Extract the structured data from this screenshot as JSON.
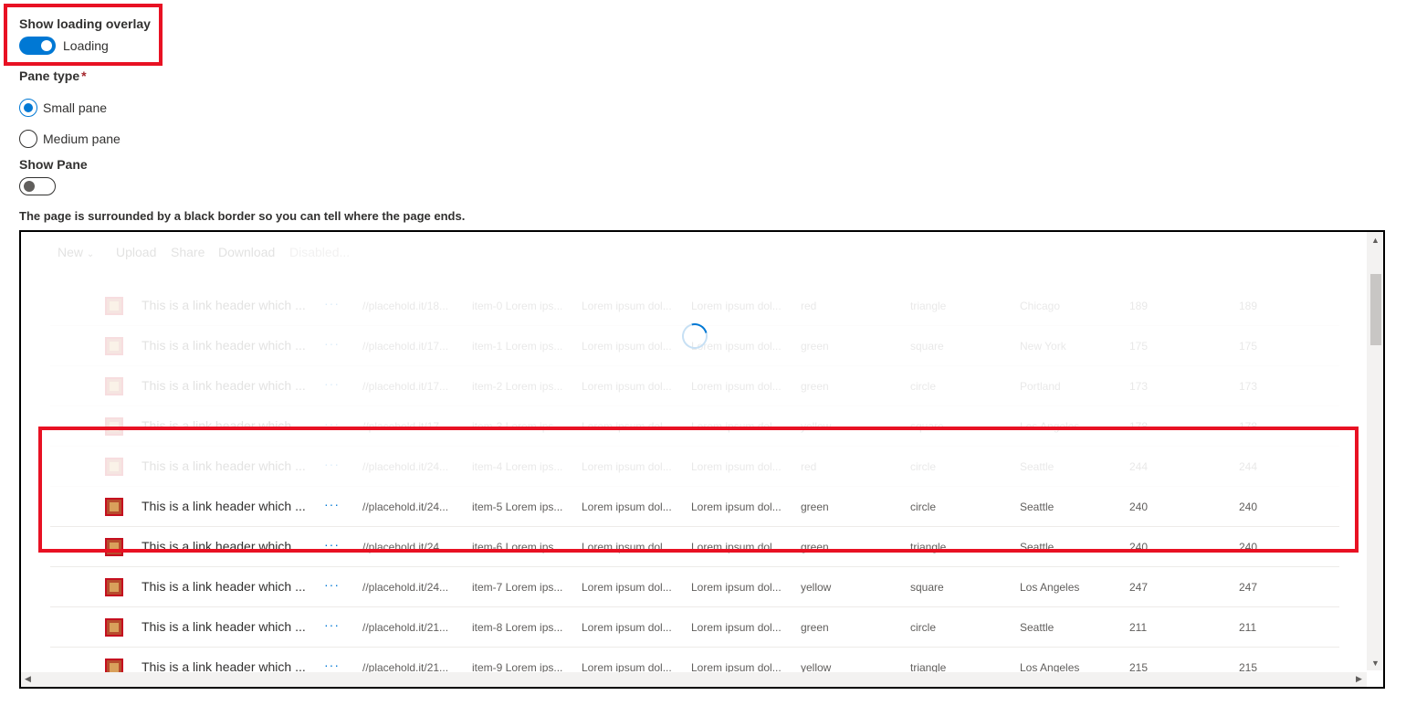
{
  "controls": {
    "loading_overlay": {
      "label": "Show loading overlay",
      "state_text": "Loading",
      "on": true
    },
    "pane_type": {
      "label": "Pane type",
      "required_mark": "*",
      "options": [
        {
          "label": "Small pane",
          "selected": true
        },
        {
          "label": "Medium pane",
          "selected": false
        }
      ]
    },
    "show_pane": {
      "label": "Show Pane",
      "on": false
    },
    "note": "The page is surrounded by a black border so you can tell where the page ends."
  },
  "commandbar": {
    "new_label": "New",
    "upload_label": "Upload",
    "share_label": "Share",
    "download_label": "Download",
    "disabled_label": "Disabled..."
  },
  "list": {
    "more_icon": "more-icon",
    "rows": [
      {
        "title": "This is a link header which ...",
        "url": "//placehold.it/18...",
        "item": "item-0 Lorem ips...",
        "desc1": "Lorem ipsum dol...",
        "desc2": "Lorem ipsum dol...",
        "color": "red",
        "shape": "triangle",
        "location": "Chicago",
        "num1": "189",
        "num2": "189"
      },
      {
        "title": "This is a link header which ...",
        "url": "//placehold.it/17...",
        "item": "item-1 Lorem ips...",
        "desc1": "Lorem ipsum dol...",
        "desc2": "Lorem ipsum dol...",
        "color": "green",
        "shape": "square",
        "location": "New York",
        "num1": "175",
        "num2": "175"
      },
      {
        "title": "This is a link header which ...",
        "url": "//placehold.it/17...",
        "item": "item-2 Lorem ips...",
        "desc1": "Lorem ipsum dol...",
        "desc2": "Lorem ipsum dol...",
        "color": "green",
        "shape": "circle",
        "location": "Portland",
        "num1": "173",
        "num2": "173"
      },
      {
        "title": "This is a link header which ...",
        "url": "//placehold.it/17...",
        "item": "item-3 Lorem ips...",
        "desc1": "Lorem ipsum dol...",
        "desc2": "Lorem ipsum dol...",
        "color": "yellow",
        "shape": "square",
        "location": "Los Angeles",
        "num1": "178",
        "num2": "178"
      },
      {
        "title": "This is a link header which ...",
        "url": "//placehold.it/24...",
        "item": "item-4 Lorem ips...",
        "desc1": "Lorem ipsum dol...",
        "desc2": "Lorem ipsum dol...",
        "color": "red",
        "shape": "circle",
        "location": "Seattle",
        "num1": "244",
        "num2": "244"
      },
      {
        "title": "This is a link header which ...",
        "url": "//placehold.it/24...",
        "item": "item-5 Lorem ips...",
        "desc1": "Lorem ipsum dol...",
        "desc2": "Lorem ipsum dol...",
        "color": "green",
        "shape": "circle",
        "location": "Seattle",
        "num1": "240",
        "num2": "240"
      },
      {
        "title": "This is a link header which ...",
        "url": "//placehold.it/24...",
        "item": "item-6 Lorem ips...",
        "desc1": "Lorem ipsum dol...",
        "desc2": "Lorem ipsum dol...",
        "color": "green",
        "shape": "triangle",
        "location": "Seattle",
        "num1": "240",
        "num2": "240"
      },
      {
        "title": "This is a link header which ...",
        "url": "//placehold.it/24...",
        "item": "item-7 Lorem ips...",
        "desc1": "Lorem ipsum dol...",
        "desc2": "Lorem ipsum dol...",
        "color": "yellow",
        "shape": "square",
        "location": "Los Angeles",
        "num1": "247",
        "num2": "247"
      },
      {
        "title": "This is a link header which ...",
        "url": "//placehold.it/21...",
        "item": "item-8 Lorem ips...",
        "desc1": "Lorem ipsum dol...",
        "desc2": "Lorem ipsum dol...",
        "color": "green",
        "shape": "circle",
        "location": "Seattle",
        "num1": "211",
        "num2": "211"
      },
      {
        "title": "This is a link header which ...",
        "url": "//placehold.it/21...",
        "item": "item-9 Lorem ips...",
        "desc1": "Lorem ipsum dol...",
        "desc2": "Lorem ipsum dol...",
        "color": "yellow",
        "shape": "triangle",
        "location": "Los Angeles",
        "num1": "215",
        "num2": "215"
      }
    ]
  },
  "colors": {
    "accent": "#0078d4",
    "highlight": "#e81123",
    "frame": "#000000"
  }
}
